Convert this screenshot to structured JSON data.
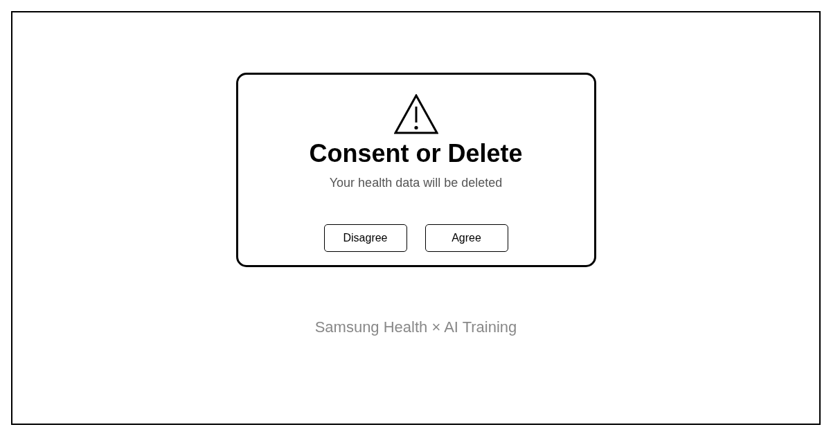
{
  "dialog": {
    "title": "Consent or Delete",
    "message": "Your health data will be deleted",
    "buttons": [
      {
        "label": "Disagree"
      },
      {
        "label": "Agree"
      }
    ]
  },
  "caption": "Samsung Health × AI Training"
}
